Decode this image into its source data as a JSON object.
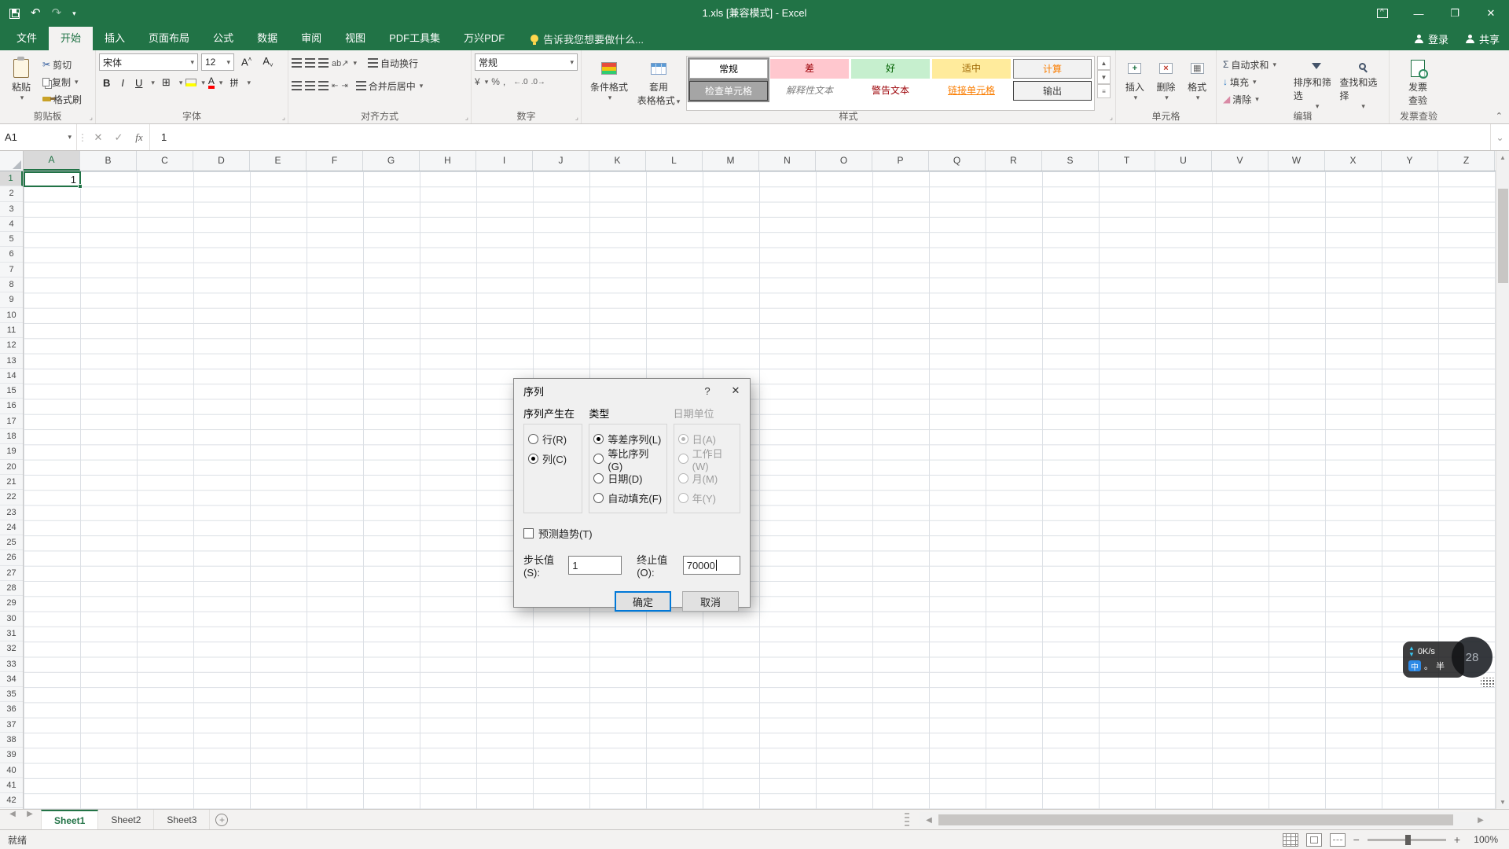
{
  "titlebar": {
    "title": "1.xls  [兼容模式] - Excel"
  },
  "ribbon_tabs": {
    "items": [
      {
        "label": "文件",
        "active": false
      },
      {
        "label": "开始",
        "active": true
      },
      {
        "label": "插入",
        "active": false
      },
      {
        "label": "页面布局",
        "active": false
      },
      {
        "label": "公式",
        "active": false
      },
      {
        "label": "数据",
        "active": false
      },
      {
        "label": "审阅",
        "active": false
      },
      {
        "label": "视图",
        "active": false
      },
      {
        "label": "PDF工具集",
        "active": false
      },
      {
        "label": "万兴PDF",
        "active": false
      }
    ],
    "tell_me": "告诉我您想要做什么...",
    "login": "登录",
    "share": "共享"
  },
  "ribbon": {
    "clipboard": {
      "label": "剪贴板",
      "paste": "粘贴",
      "cut": "剪切",
      "copy": "复制",
      "painter": "格式刷"
    },
    "font": {
      "label": "字体",
      "family": "宋体",
      "size": "12",
      "phonetic": "拼"
    },
    "alignment": {
      "label": "对齐方式",
      "wrap": "自动换行",
      "merge": "合并后居中"
    },
    "number": {
      "label": "数字",
      "format": "常规",
      "currency": "¥",
      "percent": "%",
      "comma": ",",
      "inc": "←.0",
      "dec": ".0→"
    },
    "styles": {
      "label": "样式",
      "conditional": "条件格式",
      "table_line1": "套用",
      "table_line2": "表格格式",
      "gallery": [
        {
          "label": "常规",
          "fg": "#000000",
          "bg": "#ffffff",
          "border": "#ababab",
          "selected": true
        },
        {
          "label": "差",
          "fg": "#9c0006",
          "bg": "#ffc7ce"
        },
        {
          "label": "好",
          "fg": "#006100",
          "bg": "#c6efce"
        },
        {
          "label": "适中",
          "fg": "#9c6500",
          "bg": "#ffeb9c"
        },
        {
          "label": "计算",
          "fg": "#fa7d00",
          "bg": "#f2f2f2",
          "border": "#7f7f7f"
        },
        {
          "label": "检查单元格",
          "fg": "#ffffff",
          "bg": "#a5a5a5",
          "border": "#3f3f3f",
          "selected": true
        },
        {
          "label": "解释性文本",
          "fg": "#7f7f7f",
          "bg": "#ffffff",
          "italic": true
        },
        {
          "label": "警告文本",
          "fg": "#9c0006",
          "bg": "#ffffff"
        },
        {
          "label": "链接单元格",
          "fg": "#fa7d00",
          "bg": "#ffffff",
          "underline": true
        },
        {
          "label": "输出",
          "fg": "#3f3f3f",
          "bg": "#f2f2f2",
          "border": "#3f3f3f"
        }
      ]
    },
    "cells": {
      "label": "单元格",
      "insert": "插入",
      "delete": "删除",
      "format": "格式"
    },
    "editing": {
      "label": "编辑",
      "autosum": "自动求和",
      "fill": "填充",
      "clear": "清除",
      "sort": "排序和筛选",
      "find": "查找和选择"
    },
    "invoice": {
      "label": "发票查验",
      "line1": "发票",
      "line2": "查验"
    }
  },
  "formula_bar": {
    "name_box": "A1",
    "fx": "fx",
    "value": "1"
  },
  "grid": {
    "columns": [
      "A",
      "B",
      "C",
      "D",
      "E",
      "F",
      "G",
      "H",
      "I",
      "J",
      "K",
      "L",
      "M",
      "N",
      "O",
      "P",
      "Q",
      "R",
      "S",
      "T",
      "U",
      "V",
      "W",
      "X",
      "Y",
      "Z"
    ],
    "row_count": 42,
    "active_col": "A",
    "active_row": 1,
    "active_value": "1"
  },
  "dialog": {
    "title": "序列",
    "help_icon": "?",
    "close_icon": "✕",
    "groups": {
      "series_in": {
        "label": "序列产生在",
        "disabled": false,
        "options": [
          {
            "label": "行(R)",
            "checked": false
          },
          {
            "label": "列(C)",
            "checked": true
          }
        ]
      },
      "type": {
        "label": "类型",
        "disabled": false,
        "options": [
          {
            "label": "等差序列(L)",
            "checked": true
          },
          {
            "label": "等比序列(G)",
            "checked": false
          },
          {
            "label": "日期(D)",
            "checked": false
          },
          {
            "label": "自动填充(F)",
            "checked": false
          }
        ]
      },
      "date_unit": {
        "label": "日期单位",
        "disabled": true,
        "options": [
          {
            "label": "日(A)",
            "checked": true
          },
          {
            "label": "工作日(W)",
            "checked": false
          },
          {
            "label": "月(M)",
            "checked": false
          },
          {
            "label": "年(Y)",
            "checked": false
          }
        ]
      }
    },
    "trend_label": "预测趋势(T)",
    "trend_checked": false,
    "step_label": "步长值(S):",
    "step_value": "1",
    "stop_label": "终止值(O):",
    "stop_value": "70000",
    "ok_label": "确定",
    "cancel_label": "取消"
  },
  "sheet_bar": {
    "tabs": [
      {
        "label": "Sheet1",
        "active": true
      },
      {
        "label": "Sheet2",
        "active": false
      },
      {
        "label": "Sheet3",
        "active": false
      }
    ]
  },
  "status_bar": {
    "status": "就绪",
    "zoom_level": "100%"
  },
  "overlay": {
    "speed": "0K/s",
    "ime_lang": "中",
    "ime_punct": "。",
    "ime_width": "半",
    "badge": "28"
  },
  "colors": {
    "brand": "#217346",
    "selection": "#217346",
    "grid_line": "#dce0e5"
  }
}
